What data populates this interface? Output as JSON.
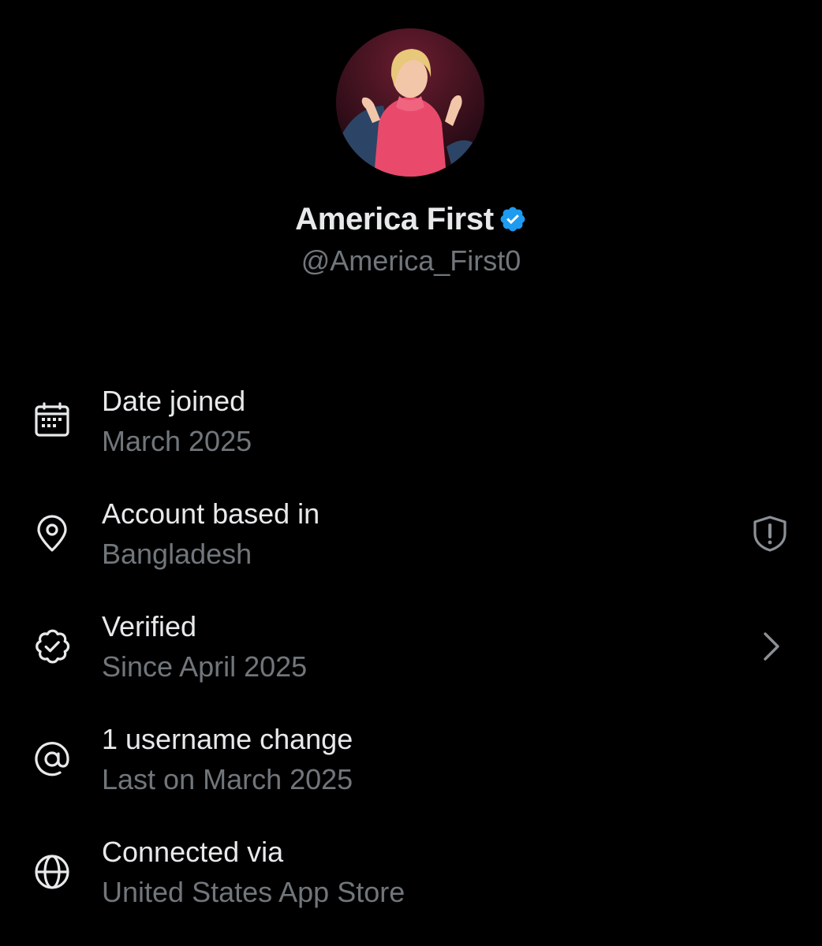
{
  "profile": {
    "avatar_alt": "Profile photo",
    "display_name": "America First",
    "handle": "@America_First0",
    "verified_icon": "verified-badge-icon",
    "badge_color": "#1d9bf0"
  },
  "info": {
    "items": [
      {
        "icon": "calendar-icon",
        "title": "Date joined",
        "subtitle": "March 2025"
      },
      {
        "icon": "location-pin-icon",
        "title": "Account based in",
        "subtitle": "Bangladesh",
        "trailing_icon": "shield-alert-icon"
      },
      {
        "icon": "verified-check-icon",
        "title": "Verified",
        "subtitle": "Since April 2025",
        "trailing_icon": "chevron-right-icon"
      },
      {
        "icon": "at-sign-icon",
        "title": "1 username change",
        "subtitle": "Last on March 2025"
      },
      {
        "icon": "globe-icon",
        "title": "Connected via",
        "subtitle": "United States App Store"
      }
    ]
  },
  "colors": {
    "background": "#000000",
    "primary_text": "#e7e9ea",
    "secondary_text": "#71767b",
    "accent": "#1d9bf0"
  }
}
